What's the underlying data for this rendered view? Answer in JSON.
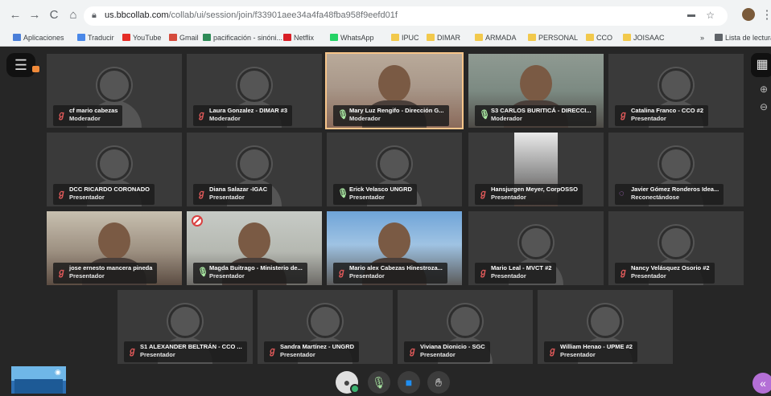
{
  "browser": {
    "url_host": "us.bbcollab.com",
    "url_path": "/collab/ui/session/join/f33901aee34a4fa48fba958f9eefd01f",
    "bookmarks": [
      {
        "label": "Aplicaciones",
        "color": "#4a7ed8"
      },
      {
        "label": "Traducir",
        "color": "#4a88e8"
      },
      {
        "label": "YouTube",
        "color": "#e52d27"
      },
      {
        "label": "Gmail",
        "color": "#d54b3d"
      },
      {
        "label": "pacificación - sinóni...",
        "color": "#2e8b57"
      },
      {
        "label": "Netflix",
        "color": "#d81f26"
      },
      {
        "label": "WhatsApp",
        "color": "#25d366"
      },
      {
        "label": "IPUC",
        "color": "#f2c94c"
      },
      {
        "label": "DIMAR",
        "color": "#f2c94c"
      },
      {
        "label": "ARMADA",
        "color": "#f2c94c"
      },
      {
        "label": "PERSONAL",
        "color": "#f2c94c"
      },
      {
        "label": "CCO",
        "color": "#f2c94c"
      },
      {
        "label": "JOISAAC",
        "color": "#f2c94c"
      }
    ],
    "more_bookmarks": "»",
    "reading_list": "Lista de lectura"
  },
  "participants": [
    {
      "name": "cf mario cabezas",
      "role": "Moderador",
      "mic": "off",
      "video": false
    },
    {
      "name": "Laura Gonzalez - DIMAR #3",
      "role": "Moderador",
      "mic": "off",
      "video": false
    },
    {
      "name": "Mary Luz Rengifo - Dirección G...",
      "role": "Moderador",
      "mic": "on",
      "video": true
    },
    {
      "name": "S3 CARLOS BURITICÁ - DIRECCI...",
      "role": "Moderador",
      "mic": "on",
      "video": true
    },
    {
      "name": "Catalina Franco - CCO #2",
      "role": "Presentador",
      "mic": "off",
      "video": false
    },
    {
      "name": "DCC RICARDO CORONADO",
      "role": "Presentador",
      "mic": "off",
      "video": false
    },
    {
      "name": "Diana Salazar -IGAC",
      "role": "Presentador",
      "mic": "off",
      "video": false
    },
    {
      "name": "Erick Velasco UNGRD",
      "role": "Presentador",
      "mic": "on",
      "video": false
    },
    {
      "name": "Hansjurgen Meyer, CorpOSSO",
      "role": "Presentador",
      "mic": "off",
      "video": true
    },
    {
      "name": "Javier Gómez Ronderos Idea...",
      "role": "Reconectándose",
      "mic": "conn",
      "video": false
    },
    {
      "name": "jose ernesto mancera pineda",
      "role": "Presentador",
      "mic": "off",
      "video": true
    },
    {
      "name": "Magda Buitrago - Ministerio de...",
      "role": "Presentador",
      "mic": "on",
      "video": true
    },
    {
      "name": "Mario alex Cabezas Hinestroza...",
      "role": "Presentador",
      "mic": "off",
      "video": true
    },
    {
      "name": "Mario Leal - MVCT #2",
      "role": "Presentador",
      "mic": "off",
      "video": false
    },
    {
      "name": "Nancy Velásquez Osorio #2",
      "role": "Presentador",
      "mic": "off",
      "video": false
    },
    {
      "name": "S1 ALEXANDER BELTRÁN - CCO ...",
      "role": "Presentador",
      "mic": "off",
      "video": false
    },
    {
      "name": "Sandra Martínez - UNGRD",
      "role": "Presentador",
      "mic": "off",
      "video": false
    },
    {
      "name": "Viviana Dionicio - SGC",
      "role": "Presentador",
      "mic": "off",
      "video": false
    },
    {
      "name": "William Henao - UPME #2",
      "role": "Presentador",
      "mic": "off",
      "video": false
    }
  ],
  "controls": {
    "status_icon": "user-status-icon",
    "mic_icon": "microphone-icon",
    "camera_icon": "camera-icon",
    "hand_icon": "raise-hand-icon",
    "chat_icon": "chat-panel-toggle-icon"
  },
  "colors": {
    "mic_on": "#a8e6a1",
    "mic_off": "#e15a5a",
    "camera": "#1f8ef1",
    "panel_toggle": "#b46fd6"
  }
}
